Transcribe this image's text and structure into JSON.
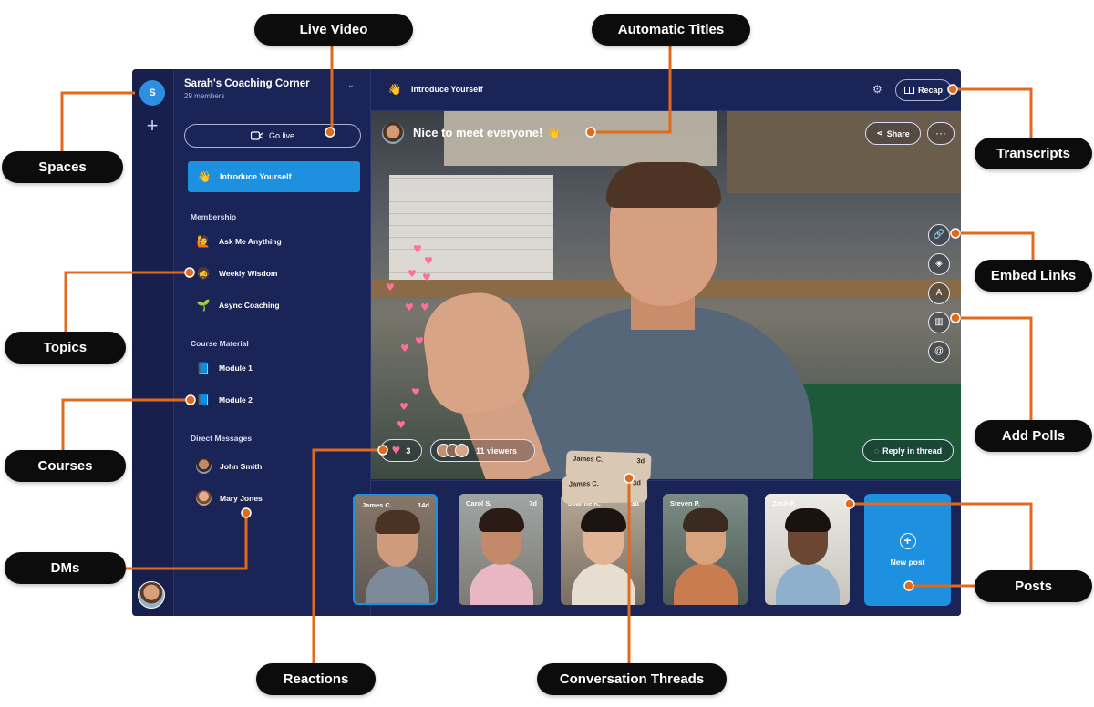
{
  "callouts": {
    "live_video": "Live Video",
    "automatic_titles": "Automatic Titles",
    "spaces": "Spaces",
    "transcripts": "Transcripts",
    "embed_links": "Embed Links",
    "topics": "Topics",
    "add_polls": "Add Polls",
    "courses": "Courses",
    "dms": "DMs",
    "posts": "Posts",
    "reactions": "Reactions",
    "conversation_threads": "Conversation Threads"
  },
  "rail": {
    "space_initial": "S",
    "add_icon": "+"
  },
  "sidebar": {
    "title": "Sarah's Coaching Corner",
    "members": "29 members",
    "go_live": "Go live",
    "active_channel": {
      "emoji": "👋",
      "label": "Introduce Yourself"
    },
    "sections": [
      {
        "label": "Membership",
        "items": [
          {
            "emoji": "🙋",
            "label": "Ask Me Anything"
          },
          {
            "emoji": "🧔",
            "label": "Weekly Wisdom"
          },
          {
            "emoji": "🌱",
            "label": "Async Coaching"
          }
        ]
      },
      {
        "label": "Course Material",
        "items": [
          {
            "emoji": "📘",
            "label": "Module 1"
          },
          {
            "emoji": "📘",
            "label": "Module 2"
          }
        ]
      },
      {
        "label": "Direct Messages",
        "items": [
          {
            "label": "John Smith"
          },
          {
            "label": "Mary Jones"
          }
        ]
      }
    ]
  },
  "topbar": {
    "emoji": "👋",
    "title": "Introduce Yourself",
    "settings_icon": "⚙",
    "recap": "Recap"
  },
  "video": {
    "caption": "Nice to meet everyone! 👋",
    "share": "Share",
    "more": "···",
    "reaction_count": "3",
    "viewers": "11 viewers",
    "reply": "Reply in thread",
    "tools": [
      "link-icon",
      "fill-icon",
      "text-icon",
      "poll-icon",
      "mention-icon"
    ]
  },
  "posts": [
    {
      "name": "James C.",
      "time": "14d"
    },
    {
      "name": "Carol S.",
      "time": "7d"
    },
    {
      "name": "Joanne K.",
      "time": "3d"
    },
    {
      "name": "Steven P.",
      "time": ""
    },
    {
      "name": "Zach P.",
      "time": ""
    }
  ],
  "threads": [
    {
      "name": "James C.",
      "time": "3d"
    },
    {
      "name": "James C.",
      "time": "3d"
    }
  ],
  "new_post": "New post",
  "colors": {
    "accent": "#1e90e0",
    "app_bg": "#1b2456",
    "callout_line": "#e06a1e",
    "heart": "#ff6f9c"
  }
}
